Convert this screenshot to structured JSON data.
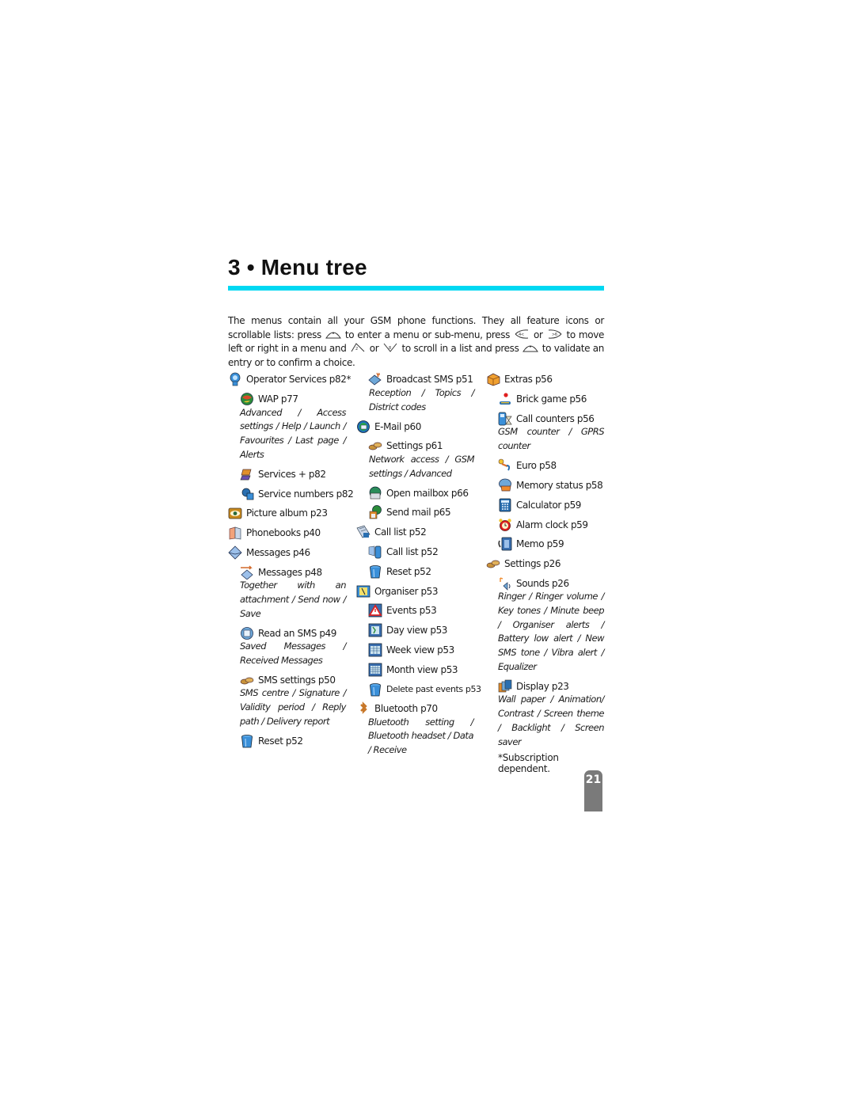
{
  "title": "3 • Menu tree",
  "accent_color": "#00d8f2",
  "intro": {
    "p1": "The menus contain all your GSM phone functions. They all feature icons or scrollable lists: press",
    "p2": "to enter a menu or sub-menu, press",
    "or1": "or",
    "p3": "to move left or right in a menu and",
    "or2": "or",
    "p4": "to scroll in a list and press",
    "p5": "to validate an entry or to confirm a choice.",
    "keys": [
      "ok-key-icon",
      "left-key-icon",
      "right-key-icon",
      "up-key-icon",
      "down-key-icon",
      "ok-key-icon"
    ]
  },
  "columns": [
    {
      "items": [
        {
          "label": "Operator Services p82",
          "star": "*",
          "level": 1,
          "icon": "operator-services-icon"
        },
        {
          "label": "WAP p77",
          "level": 2,
          "icon": "wap-globe-icon",
          "sub": "Advanced / Access settings / Help / Launch / Favourites / Last page / Alerts"
        },
        {
          "label": "Services + p82",
          "level": 2,
          "icon": "services-plus-icon"
        },
        {
          "label": "Service numbers p82",
          "level": 2,
          "icon": "service-numbers-icon"
        },
        {
          "label": "Picture album p23",
          "level": 1,
          "icon": "picture-album-icon"
        },
        {
          "label": "Phonebooks p40",
          "level": 1,
          "icon": "phonebooks-icon"
        },
        {
          "label": "Messages p46",
          "level": 1,
          "icon": "messages-envelope-icon"
        },
        {
          "label": "Messages p48",
          "level": 2,
          "icon": "send-message-icon",
          "sub": "Together with an attachment / Send now / Save"
        },
        {
          "label": "Read an SMS p49",
          "level": 2,
          "icon": "read-sms-icon",
          "sub": "Saved Messages / Received Messages"
        },
        {
          "label": "SMS settings p50",
          "level": 2,
          "icon": "sms-settings-icon",
          "sub": "SMS centre / Signature / Validity period / Reply path / Delivery report"
        },
        {
          "label": "Reset p52",
          "level": 2,
          "icon": "trash-bin-icon"
        }
      ]
    },
    {
      "items": [
        {
          "label": "Broadcast SMS p51",
          "level": 2,
          "icon": "broadcast-sms-icon",
          "sub": "Reception / Topics / District codes"
        },
        {
          "label": "E-Mail p60",
          "level": 1,
          "icon": "email-globe-icon"
        },
        {
          "label": "Settings p61",
          "level": 2,
          "icon": "settings-icon",
          "sub": "Network access / GSM settings / Advanced"
        },
        {
          "label": "Open mailbox p66",
          "level": 2,
          "icon": "open-mailbox-icon"
        },
        {
          "label": "Send mail p65",
          "level": 2,
          "icon": "send-mail-icon"
        },
        {
          "label": "Call list p52",
          "level": 1,
          "icon": "call-list-icon"
        },
        {
          "label": "Call list p52",
          "level": 2,
          "icon": "call-list-sub-icon"
        },
        {
          "label": "Reset p52",
          "level": 2,
          "icon": "trash-bin-icon"
        },
        {
          "label": "Organiser p53",
          "level": 1,
          "icon": "organiser-icon"
        },
        {
          "label": "Events p53",
          "level": 2,
          "icon": "events-alert-icon"
        },
        {
          "label": "Day view p53",
          "level": 2,
          "icon": "day-view-icon"
        },
        {
          "label": "Week view p53",
          "level": 2,
          "icon": "week-view-icon"
        },
        {
          "label": "Month view p53",
          "level": 2,
          "icon": "month-view-icon"
        },
        {
          "label": "Delete past events p53",
          "level": 2,
          "icon": "trash-bin-icon",
          "small": true
        },
        {
          "label": "Bluetooth p70",
          "level": 1,
          "icon": "bluetooth-icon",
          "sub": "Bluetooth setting / Bluetooth headset / Data / Receive"
        }
      ]
    },
    {
      "items": [
        {
          "label": "Extras p56",
          "level": 1,
          "icon": "extras-box-icon"
        },
        {
          "label": "Brick game p56",
          "level": 2,
          "icon": "brick-game-icon"
        },
        {
          "label": "Call counters p56",
          "level": 2,
          "icon": "call-counters-icon",
          "sub": "GSM counter / GPRS counter"
        },
        {
          "label": "Euro p58",
          "level": 2,
          "icon": "euro-icon"
        },
        {
          "label": "Memory status p58",
          "level": 2,
          "icon": "memory-status-icon"
        },
        {
          "label": "Calculator p59",
          "level": 2,
          "icon": "calculator-icon"
        },
        {
          "label": "Alarm clock p59",
          "level": 2,
          "icon": "alarm-clock-icon"
        },
        {
          "label": "Memo p59",
          "level": 2,
          "icon": "memo-icon"
        },
        {
          "label": "Settings p26",
          "level": 1,
          "icon": "settings-icon"
        },
        {
          "label": "Sounds p26",
          "level": 2,
          "icon": "sounds-icon",
          "sub": "Ringer / Ringer volume / Key tones / Minute beep / Organiser alerts / Battery low alert / New SMS tone / Vibra alert / Equalizer"
        },
        {
          "label": "Display p23",
          "level": 2,
          "icon": "display-icon",
          "sub": "Wall paper / Animation/ Contrast / Screen theme / Backlight / Screen saver"
        }
      ],
      "footnote": "*Subscription dependent."
    }
  ],
  "page_number": "21"
}
